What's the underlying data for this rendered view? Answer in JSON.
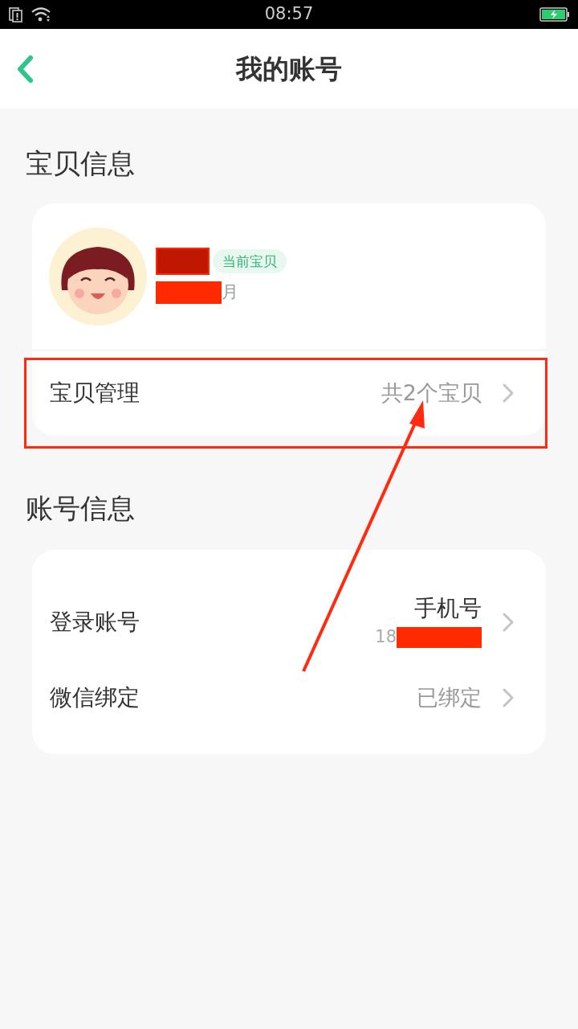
{
  "status_bar": {
    "time": "08:57"
  },
  "header": {
    "title": "我的账号"
  },
  "baby_section": {
    "title": "宝贝信息",
    "profile": {
      "badge": "当前宝贝",
      "age_suffix": "月"
    },
    "rows": [
      {
        "label": "宝贝管理",
        "value": "共2个宝贝"
      }
    ]
  },
  "account_section": {
    "title": "账号信息",
    "rows": [
      {
        "kind": "stacked",
        "label": "登录账号",
        "value": "手机号",
        "detail": "18"
      },
      {
        "kind": "plain",
        "label": "微信绑定",
        "value": "已绑定"
      }
    ]
  }
}
